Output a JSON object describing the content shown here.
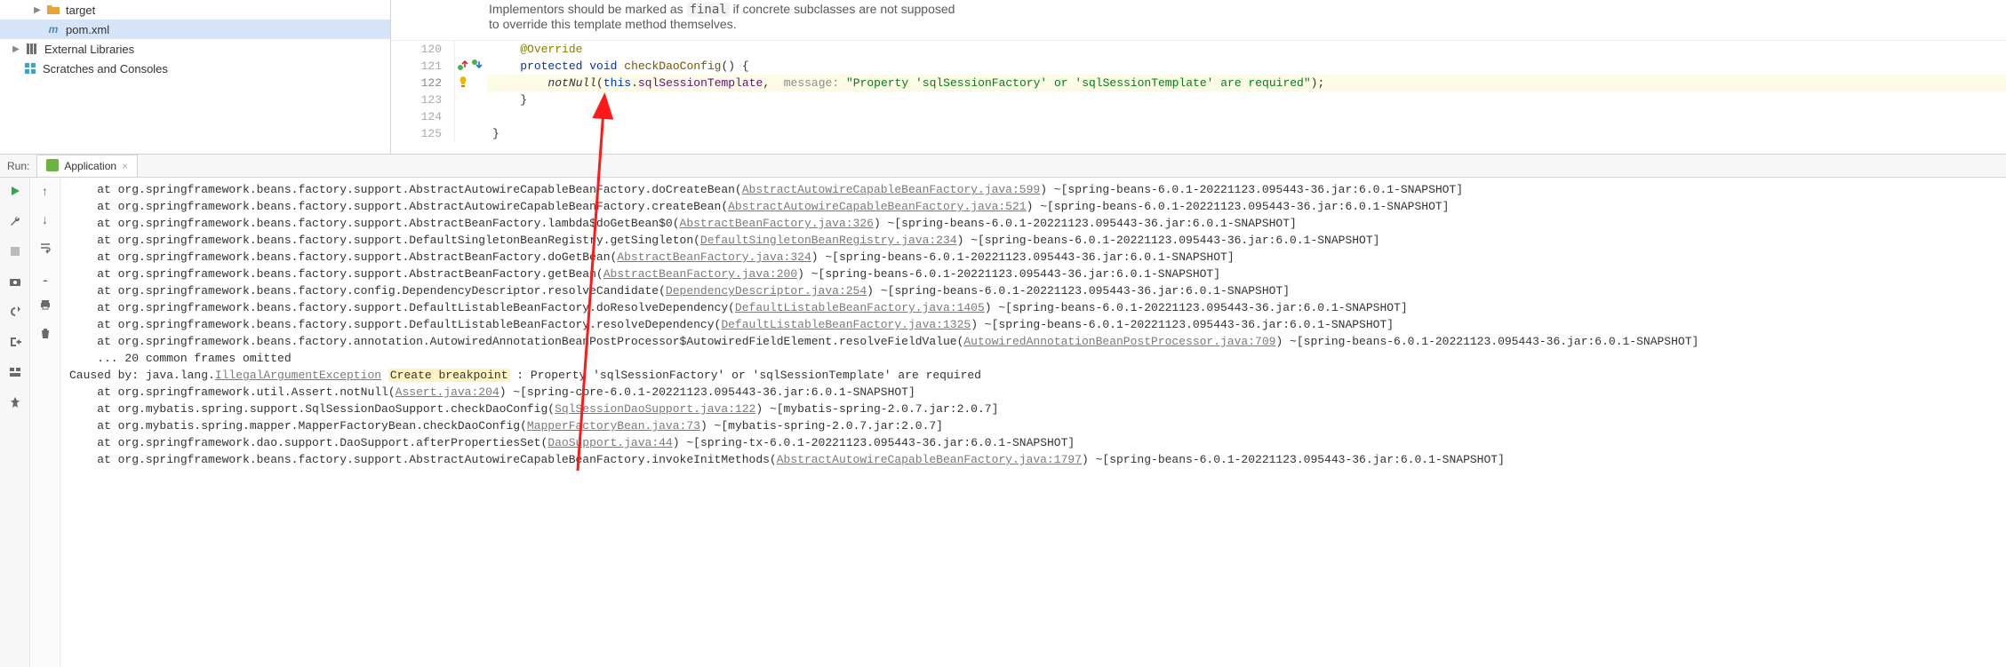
{
  "project": {
    "target": {
      "label": "target"
    },
    "pom": {
      "label": "pom.xml"
    },
    "external_libraries": {
      "label": "External Libraries"
    },
    "scratches": {
      "label": "Scratches and Consoles"
    }
  },
  "icons": {
    "expander_right": "▶",
    "expander_down": "▼",
    "close_x": "×",
    "up": "↑",
    "down": "↓"
  },
  "doc": {
    "line1_pre": "Implementors should be marked as ",
    "line1_code": "final",
    "line1_post": " if concrete subclasses are not supposed",
    "line2": "to override this template method themselves."
  },
  "gutter": {
    "lines": [
      "120",
      "121",
      "122",
      "123",
      "124",
      "125"
    ],
    "bulb_title": "Show intention actions",
    "override_up_title": "Overrides method",
    "override_down_title": "Is overridden"
  },
  "code": {
    "l120": {
      "indent": "    ",
      "anno": "@Override"
    },
    "l121": {
      "indent": "    ",
      "kw1": "protected",
      "space": " ",
      "kw2": "void",
      "methodName": " checkDaoConfig",
      "rest": "() {"
    },
    "l122": {
      "indent": "        ",
      "call": "notNull",
      "open": "(",
      "this": "this",
      "dot": ".",
      "field": "sqlSessionTemplate",
      "comma": ",  ",
      "hint": "message:",
      "hint_sp": " ",
      "str": "\"Property 'sqlSessionFactory' or 'sqlSessionTemplate' are required\"",
      "close": ");"
    },
    "l123": {
      "text": "    }"
    },
    "l124": {
      "text": ""
    },
    "l125": {
      "text": "}"
    }
  },
  "run": {
    "label": "Run:",
    "tab": {
      "label": "Application"
    },
    "toolbar": {
      "rerun": "Rerun",
      "wrench": "Edit Configuration",
      "stop": "Stop",
      "camera": "Dump Threads",
      "restart": "Restart",
      "exit": "Exit",
      "layout": "Layout",
      "more": "More",
      "up": "Up the stack",
      "down": "Down the stack",
      "soft_wrap": "Soft-Wrap",
      "scroll_end": "Scroll to End",
      "print": "Print",
      "clear": "Clear All"
    }
  },
  "console_lines": [
    {
      "pre": "    at org.springframework.beans.factory.support.AbstractAutowireCapableBeanFactory.doCreateBean(",
      "link": "AbstractAutowireCapableBeanFactory.java:599",
      "post": ") ~[spring-beans-6.0.1-20221123.095443-36.jar:6.0.1-SNAPSHOT]"
    },
    {
      "pre": "    at org.springframework.beans.factory.support.AbstractAutowireCapableBeanFactory.createBean(",
      "link": "AbstractAutowireCapableBeanFactory.java:521",
      "post": ") ~[spring-beans-6.0.1-20221123.095443-36.jar:6.0.1-SNAPSHOT]"
    },
    {
      "pre": "    at org.springframework.beans.factory.support.AbstractBeanFactory.lambda$doGetBean$0(",
      "link": "AbstractBeanFactory.java:326",
      "post": ") ~[spring-beans-6.0.1-20221123.095443-36.jar:6.0.1-SNAPSHOT]"
    },
    {
      "pre": "    at org.springframework.beans.factory.support.DefaultSingletonBeanRegistry.getSingleton(",
      "link": "DefaultSingletonBeanRegistry.java:234",
      "post": ") ~[spring-beans-6.0.1-20221123.095443-36.jar:6.0.1-SNAPSHOT]"
    },
    {
      "pre": "    at org.springframework.beans.factory.support.AbstractBeanFactory.doGetBean(",
      "link": "AbstractBeanFactory.java:324",
      "post": ") ~[spring-beans-6.0.1-20221123.095443-36.jar:6.0.1-SNAPSHOT]"
    },
    {
      "pre": "    at org.springframework.beans.factory.support.AbstractBeanFactory.getBean(",
      "link": "AbstractBeanFactory.java:200",
      "post": ") ~[spring-beans-6.0.1-20221123.095443-36.jar:6.0.1-SNAPSHOT]"
    },
    {
      "pre": "    at org.springframework.beans.factory.config.DependencyDescriptor.resolveCandidate(",
      "link": "DependencyDescriptor.java:254",
      "post": ") ~[spring-beans-6.0.1-20221123.095443-36.jar:6.0.1-SNAPSHOT]"
    },
    {
      "pre": "    at org.springframework.beans.factory.support.DefaultListableBeanFactory.doResolveDependency(",
      "link": "DefaultListableBeanFactory.java:1405",
      "post": ") ~[spring-beans-6.0.1-20221123.095443-36.jar:6.0.1-SNAPSHOT]"
    },
    {
      "pre": "    at org.springframework.beans.factory.support.DefaultListableBeanFactory.resolveDependency(",
      "link": "DefaultListableBeanFactory.java:1325",
      "post": ") ~[spring-beans-6.0.1-20221123.095443-36.jar:6.0.1-SNAPSHOT]"
    },
    {
      "pre": "    at org.springframework.beans.factory.annotation.AutowiredAnnotationBeanPostProcessor$AutowiredFieldElement.resolveFieldValue(",
      "link": "AutowiredAnnotationBeanPostProcessor.java:709",
      "post": ") ~[spring-beans-6.0.1-20221123.095443-36.jar:6.0.1-SNAPSHOT]"
    },
    {
      "pre": "    ... 20 common frames omitted",
      "link": "",
      "post": ""
    },
    {
      "pre": "Caused by: java.lang.",
      "link": "IllegalArgumentException",
      "bp": "Create breakpoint",
      "post2": " : Property 'sqlSessionFactory' or 'sqlSessionTemplate' are required"
    },
    {
      "pre": "    at org.springframework.util.Assert.notNull(",
      "link": "Assert.java:204",
      "post": ") ~[spring-core-6.0.1-20221123.095443-36.jar:6.0.1-SNAPSHOT]"
    },
    {
      "pre": "    at org.mybatis.spring.support.SqlSessionDaoSupport.checkDaoConfig(",
      "link": "SqlSessionDaoSupport.java:122",
      "post": ") ~[mybatis-spring-2.0.7.jar:2.0.7]"
    },
    {
      "pre": "    at org.mybatis.spring.mapper.MapperFactoryBean.checkDaoConfig(",
      "link": "MapperFactoryBean.java:73",
      "post": ") ~[mybatis-spring-2.0.7.jar:2.0.7]"
    },
    {
      "pre": "    at org.springframework.dao.support.DaoSupport.afterPropertiesSet(",
      "link": "DaoSupport.java:44",
      "post": ") ~[spring-tx-6.0.1-20221123.095443-36.jar:6.0.1-SNAPSHOT]"
    },
    {
      "pre": "    at org.springframework.beans.factory.support.AbstractAutowireCapableBeanFactory.invokeInitMethods(",
      "link": "AbstractAutowireCapableBeanFactory.java:1797",
      "post": ") ~[spring-beans-6.0.1-20221123.095443-36.jar:6.0.1-SNAPSHOT]"
    }
  ]
}
